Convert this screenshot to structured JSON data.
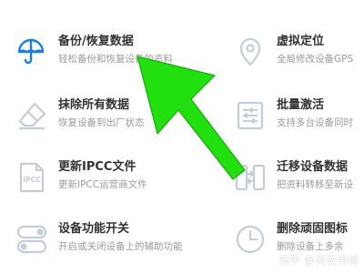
{
  "features": [
    {
      "title": "备份/恢复数据",
      "desc": "轻松备份和恢复设备的资料",
      "icon": "umbrella-icon"
    },
    {
      "title": "虚拟定位",
      "desc": "全局修改设备GPS",
      "icon": "location-pin-icon"
    },
    {
      "title": "抹除所有数据",
      "desc": "恢复设备到出厂状态",
      "icon": "eraser-icon"
    },
    {
      "title": "批量激活",
      "desc": "支持多台设备同时",
      "icon": "sliders-icon"
    },
    {
      "title": "更新IPCC文件",
      "desc": "更新IPCC运营商文件",
      "icon": "ipcc-file-icon",
      "icon_text": "IPCC"
    },
    {
      "title": "迁移设备数据",
      "desc": "把资料转移至新设",
      "icon": "transfer-icon"
    },
    {
      "title": "设备功能开关",
      "desc": "开启或关闭设备上的辅助功能",
      "icon": "toggle-switch-icon"
    },
    {
      "title": "删除顽固图标",
      "desc": "删除设备上多余",
      "icon": "clock-icon"
    }
  ],
  "watermark": "知乎 @另说另语",
  "colors": {
    "accent_blue": "#1a7de0",
    "icon_gray": "#c3cdd8",
    "title": "#333333",
    "desc": "#9a9a9a",
    "arrow_green": "#22e00f"
  }
}
